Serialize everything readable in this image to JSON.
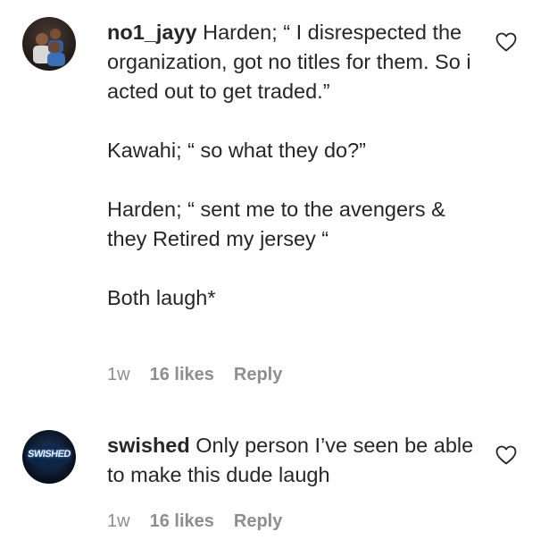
{
  "comments": [
    {
      "username": "no1_jayy",
      "text": " Harden; “ I disrespected the organization, got no titles for them. So i acted out to get traded.”\n\nKawahi; “ so what they do?”\n\nHarden; “ sent me to the avengers & they Retired my jersey “\n\nBoth laugh*",
      "time": "1w",
      "likes": "16 likes",
      "reply_label": "Reply",
      "avatar_icon": "user-photo-avatar",
      "like_icon": "heart-outline-icon"
    },
    {
      "username": "swished",
      "text": " Only person I’ve seen be able to make this dude laugh",
      "time": "1w",
      "likes": "16 likes",
      "reply_label": "Reply",
      "avatar_icon": "swished-logo-avatar",
      "avatar_logo_text": "SWISHED",
      "like_icon": "heart-outline-icon"
    }
  ]
}
